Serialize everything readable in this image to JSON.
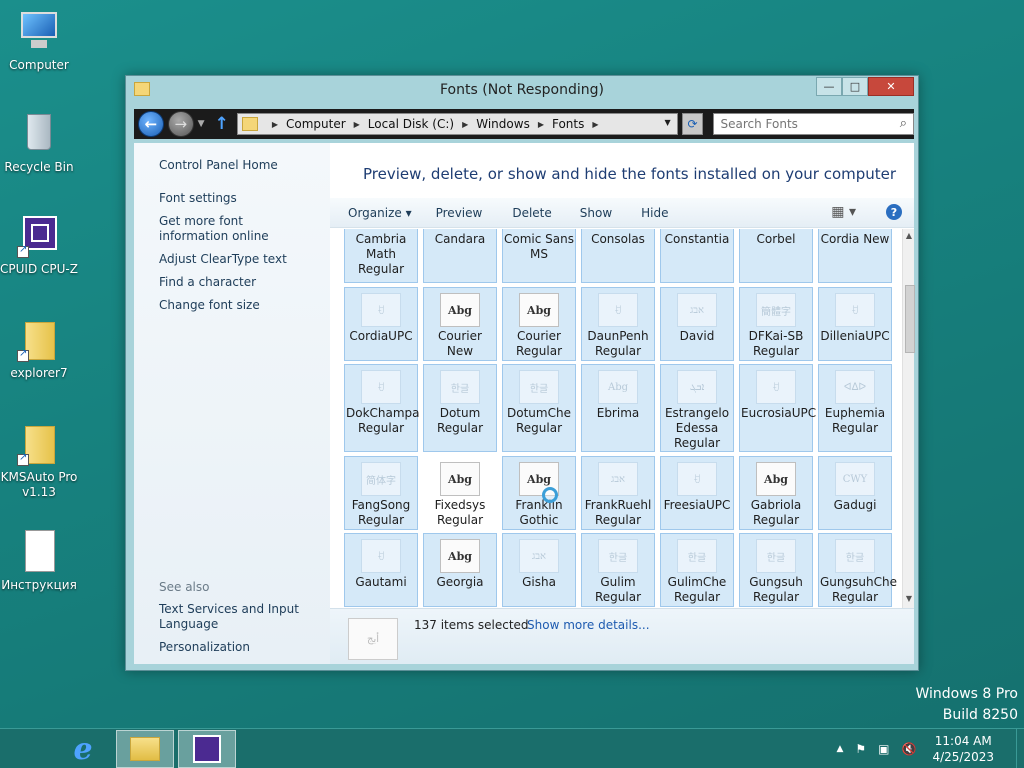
{
  "desktop": {
    "icons": [
      {
        "label": "Computer",
        "icon": "computer-icon"
      },
      {
        "label": "Recycle Bin",
        "icon": "recycle-bin-icon"
      },
      {
        "label": "CPUID CPU-Z",
        "icon": "cpuz-icon"
      },
      {
        "label": "explorer7",
        "icon": "folder-icon"
      },
      {
        "label": "KMSAuto Pro v1.13",
        "icon": "folder-icon"
      },
      {
        "label": "Инструкция",
        "icon": "text-document-icon"
      }
    ],
    "watermark": {
      "line1": "Windows 8 Pro",
      "line2": "Build 8250"
    }
  },
  "window": {
    "title": "Fonts (Not Responding)",
    "caption": {
      "minimize": "—",
      "maximize": "□",
      "close": "✕"
    },
    "address": {
      "crumbs": [
        "Computer",
        "Local Disk (C:)",
        "Windows",
        "Fonts"
      ]
    },
    "search": {
      "placeholder": "Search Fonts"
    },
    "left_pane": {
      "home": "Control Panel Home",
      "links": [
        "Font settings",
        "Get more font information online",
        "Adjust ClearType text",
        "Find a character",
        "Change font size"
      ],
      "see_also": "See also",
      "see_also_links": [
        "Text Services and Input Language",
        "Personalization"
      ]
    },
    "heading": "Preview, delete, or show and hide the fonts installed on your computer",
    "toolbar": {
      "organize": "Organize ▾",
      "preview": "Preview",
      "delete": "Delete",
      "show": "Show",
      "hide": "Hide",
      "view": "▦ ▾",
      "help": "?"
    },
    "fonts": [
      {
        "name": "Cambria Math Regular",
        "glyph": ""
      },
      {
        "name": "Candara",
        "glyph": ""
      },
      {
        "name": "Comic Sans MS",
        "glyph": ""
      },
      {
        "name": "Consolas",
        "glyph": ""
      },
      {
        "name": "Constantia",
        "glyph": ""
      },
      {
        "name": "Corbel",
        "glyph": ""
      },
      {
        "name": "Cordia New",
        "glyph": ""
      },
      {
        "name": "CordiaUPC",
        "glyph": "ꀀ"
      },
      {
        "name": "Courier New",
        "glyph": "Abg"
      },
      {
        "name": "Courier Regular",
        "glyph": "Abg"
      },
      {
        "name": "DaunPenh Regular",
        "glyph": "ꀀ"
      },
      {
        "name": "David",
        "glyph": "אבג"
      },
      {
        "name": "DFKai-SB Regular",
        "glyph": "簡體字"
      },
      {
        "name": "DilleniaUPC",
        "glyph": "ꀀ"
      },
      {
        "name": "DokChampa Regular",
        "glyph": "ꀀ"
      },
      {
        "name": "Dotum Regular",
        "glyph": "한글"
      },
      {
        "name": "DotumChe Regular",
        "glyph": "한글"
      },
      {
        "name": "Ebrima",
        "glyph": "Abg"
      },
      {
        "name": "Estrangelo Edessa Regular",
        "glyph": "ܐܒܓ"
      },
      {
        "name": "EucrosiaUPC",
        "glyph": "ꀀ"
      },
      {
        "name": "Euphemia Regular",
        "glyph": "ᐊᐃᐅ"
      },
      {
        "name": "FangSong Regular",
        "glyph": "简体字"
      },
      {
        "name": "Fixedsys Regular",
        "glyph": "Abg"
      },
      {
        "name": "Franklin Gothic",
        "glyph": "Abg"
      },
      {
        "name": "FrankRuehl Regular",
        "glyph": "אבג"
      },
      {
        "name": "FreesiaUPC",
        "glyph": "ꀀ"
      },
      {
        "name": "Gabriola Regular",
        "glyph": "Abg"
      },
      {
        "name": "Gadugi",
        "glyph": "CWY"
      },
      {
        "name": "Gautami",
        "glyph": "ꀀ"
      },
      {
        "name": "Georgia",
        "glyph": "Abg"
      },
      {
        "name": "Gisha",
        "glyph": "אבג"
      },
      {
        "name": "Gulim Regular",
        "glyph": "한글"
      },
      {
        "name": "GulimChe Regular",
        "glyph": "한글"
      },
      {
        "name": "Gungsuh Regular",
        "glyph": "한글"
      },
      {
        "name": "GungsuhChe Regular",
        "glyph": "한글"
      }
    ],
    "details": {
      "count": "137 items selected",
      "link": "Show more details...",
      "glyph": "أبج"
    }
  },
  "taskbar": {
    "clock_time": "11:04 AM",
    "clock_date": "4/25/2023",
    "tray": {
      "chevron": "▲",
      "flag": "⚑",
      "network": "▣",
      "volume": "🔇"
    }
  }
}
